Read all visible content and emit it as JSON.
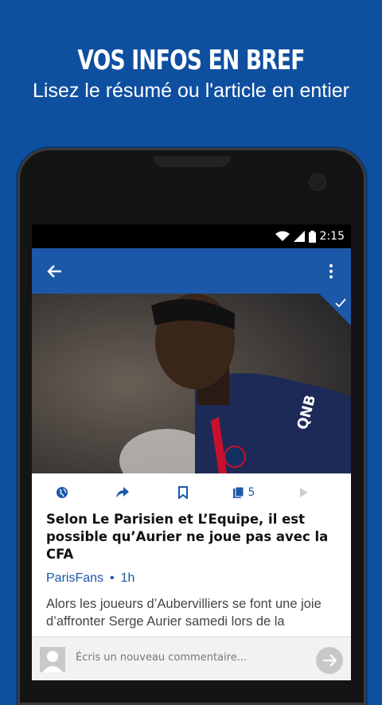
{
  "promo": {
    "title": "VOS INFOS EN BREF",
    "subtitle": "Lisez le résumé ou l'article en entier"
  },
  "status_bar": {
    "time": "2:15"
  },
  "app_bar": {
    "back_icon": "arrow-left-icon",
    "menu_icon": "more-vert-icon"
  },
  "actions": {
    "web_icon": "globe-icon",
    "share_icon": "share-icon",
    "bookmark_icon": "bookmark-icon",
    "count": "5",
    "next_icon": "play-icon"
  },
  "article": {
    "title": "Selon Le Parisien et L’Equipe, il est possible qu’Aurier ne joue pas avec la CFA",
    "source": "ParisFans",
    "time_ago": "1h",
    "summary": "Alors les joueurs d’Aubervilliers se font une joie d’affronter Serge Aurier samedi lors de la"
  },
  "comment": {
    "placeholder": "Écris un nouveau commentaire..."
  },
  "colors": {
    "background": "#0f4f9f",
    "app_bar": "#1b58a8",
    "accent": "#1b58a8"
  }
}
